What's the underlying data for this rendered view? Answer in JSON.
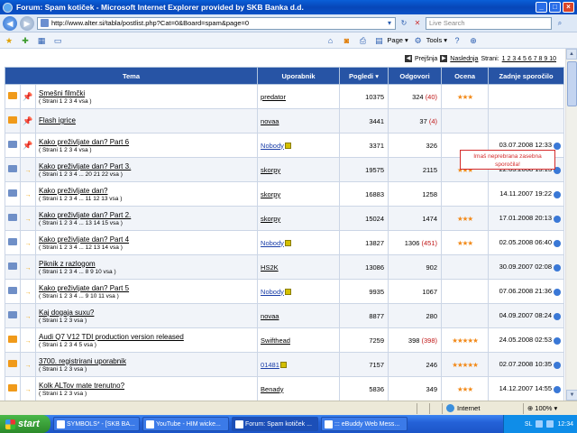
{
  "browser": {
    "title": "Forum: Spam kotiček - Microsoft Internet Explorer provided by SKB Banka d.d.",
    "url": "http://www.alter.si/tabla/postlist.php?Cat=0&Board=spam&page=0",
    "search_placeholder": "Live Search",
    "cmd": {
      "page": "Page",
      "tools": "Tools"
    }
  },
  "pager": {
    "prev": "Prejšnja",
    "next": "Naslednja",
    "pages_label": "Strani:",
    "pages": "1 2 3 4 5 6 7 8 9 10"
  },
  "table": {
    "headers": {
      "topic": "Tema",
      "user": "Uporabnik",
      "views": "Pogledi",
      "replies": "Odgovori",
      "rating": "Ocena",
      "last": "Zadnje sporočilo"
    },
    "rows": [
      {
        "title": "Smešni filmčki",
        "pages": "( Strani 1 2 3 4 vsa )",
        "user": "predator",
        "views": "10375",
        "replies": "324",
        "new": "(40)",
        "stars": "★★★",
        "last": "",
        "folder": "hot",
        "pinned": true
      },
      {
        "title": "Flash igrice",
        "pages": "",
        "user": "novaa",
        "views": "3441",
        "replies": "37",
        "new": "(4)",
        "stars": "",
        "last": "",
        "folder": "hot",
        "pinned": true
      },
      {
        "title": "Kako preživljate dan? Part 6",
        "pages": "( Strani 1 2 3 4 vsa )",
        "user": "Nobody",
        "views": "3371",
        "replies": "326",
        "new": "",
        "stars": "",
        "last": "03.07.2008 12:33",
        "folder": "normal",
        "pinned": true
      },
      {
        "title": "Kako preživljate dan? Part 3.",
        "pages": "( Strani 1 2 3 4 ... 20 21 22 vsa )",
        "user": "skorpy",
        "views": "19575",
        "replies": "2115",
        "new": "",
        "stars": "★★★",
        "last": "22.03.2008 13:13",
        "folder": "locked",
        "pinned": false
      },
      {
        "title": "Kako preživljate dan?",
        "pages": "( Strani 1 2 3 4 ... 11 12 13 vsa )",
        "user": "skorpy",
        "views": "16883",
        "replies": "1258",
        "new": "",
        "stars": "",
        "last": "14.11.2007 19:22",
        "folder": "locked",
        "pinned": false
      },
      {
        "title": "Kako preživljate dan? Part 2.",
        "pages": "( Strani 1 2 3 4 ... 13 14 15 vsa )",
        "user": "skorpy",
        "views": "15024",
        "replies": "1474",
        "new": "",
        "stars": "★★★",
        "last": "17.01.2008 20:13",
        "folder": "locked",
        "pinned": false
      },
      {
        "title": "Kako preživljate dan? Part 4",
        "pages": "( Strani 1 2 3 4 ... 12 13 14 vsa )",
        "user": "Nobody",
        "views": "13827",
        "replies": "1306",
        "new": "(451)",
        "stars": "★★★",
        "last": "02.05.2008 06:40",
        "folder": "locked",
        "pinned": false
      },
      {
        "title": "Piknik z razlogom",
        "pages": "( Strani 1 2 3 4 ... 8 9 10 vsa )",
        "user": "HS2K",
        "views": "13086",
        "replies": "902",
        "new": "",
        "stars": "",
        "last": "30.09.2007 02:08",
        "folder": "locked",
        "pinned": false
      },
      {
        "title": "Kako preživljate dan? Part 5",
        "pages": "( Strani 1 2 3 4 ... 9 10 11 vsa )",
        "user": "Nobody",
        "views": "9935",
        "replies": "1067",
        "new": "",
        "stars": "",
        "last": "07.06.2008 21:36",
        "folder": "locked",
        "pinned": false
      },
      {
        "title": "Kaj dogaja suxu?",
        "pages": "( Strani 1 2 3 vsa )",
        "user": "novaa",
        "views": "8877",
        "replies": "280",
        "new": "",
        "stars": "",
        "last": "04.09.2007 08:24",
        "folder": "locked",
        "pinned": false
      },
      {
        "title": "Audi Q7 V12 TDI production version released",
        "pages": "( Strani 1 2 3 4 5 vsa )",
        "user": "Swifthead",
        "views": "7259",
        "replies": "398",
        "new": "(398)",
        "stars": "★★★★★",
        "last": "24.05.2008 02:53",
        "folder": "hot",
        "pinned": false
      },
      {
        "title": "3700. registrirani uporabnik",
        "pages": "( Strani 1 2 3 vsa )",
        "user": "01481",
        "views": "7157",
        "replies": "246",
        "new": "",
        "stars": "★★★★★",
        "last": "02.07.2008 10:35",
        "folder": "hot",
        "pinned": false
      },
      {
        "title": "Kolk ALTov mate trenutno?",
        "pages": "( Strani 1 2 3 vsa )",
        "user": "Benady",
        "views": "5836",
        "replies": "349",
        "new": "",
        "stars": "★★★",
        "last": "14.12.2007 14:55",
        "folder": "hot",
        "pinned": false
      }
    ]
  },
  "tooltip": "Imaš neprebrana zasebna sporočila!",
  "status": {
    "zone": "Internet",
    "zoom": "100%"
  },
  "taskbar": {
    "start": "start",
    "tasks": [
      "SYMBOLS* - [SKB BA...",
      "YouTube - HIM wicke...",
      "Forum: Spam kotiček ...",
      "::: eBuddy Web Mess..."
    ],
    "lang": "SL",
    "clock": "12:34"
  }
}
